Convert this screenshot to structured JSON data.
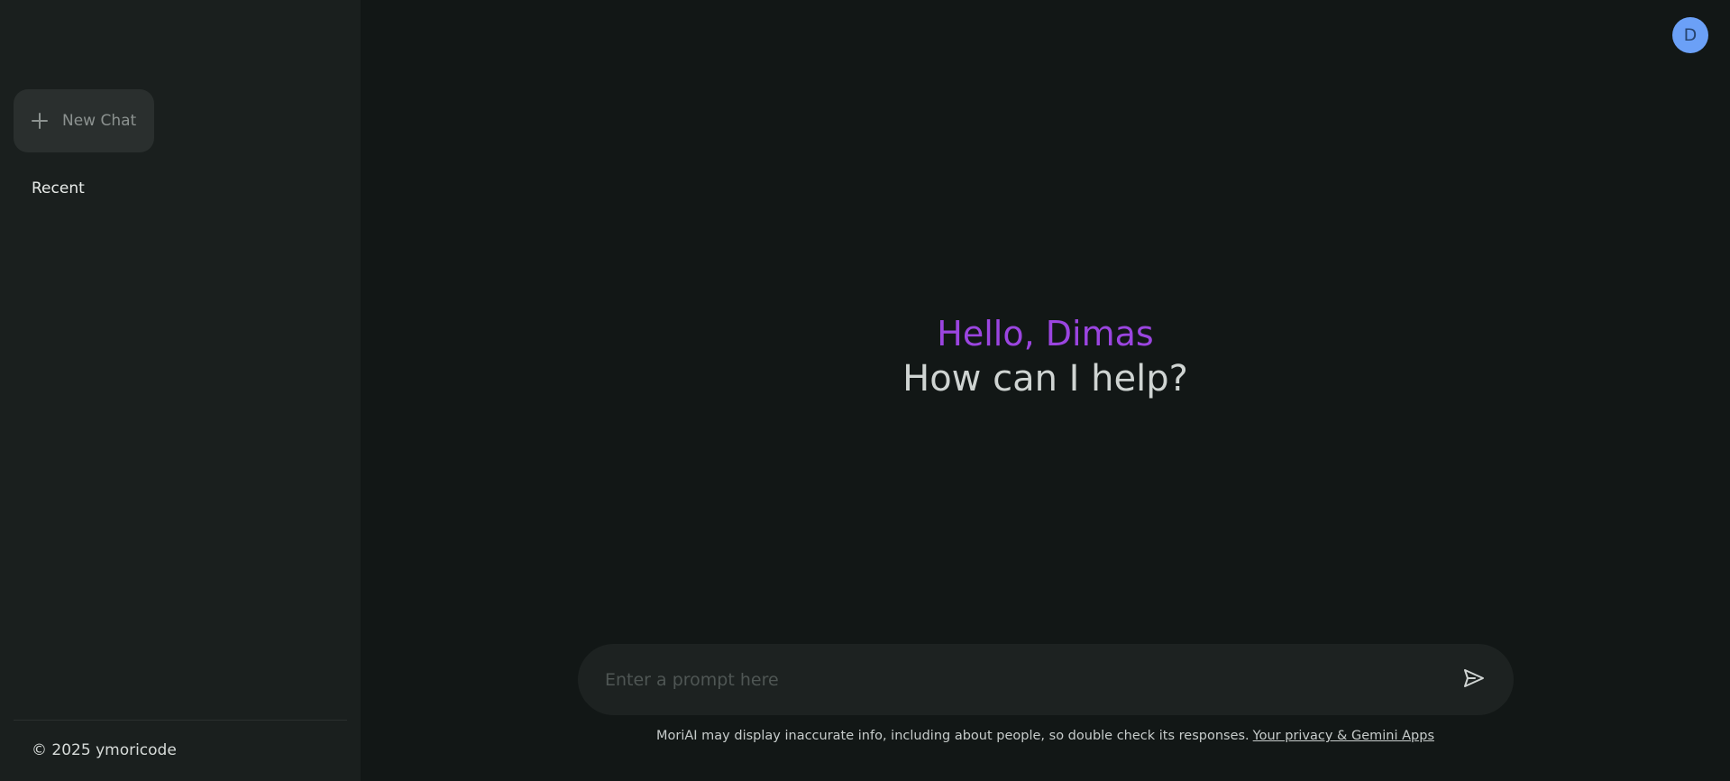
{
  "sidebar": {
    "new_chat_label": "New Chat",
    "recent_label": "Recent",
    "footer": "© 2025 ymoricode"
  },
  "header": {
    "avatar_initial": "D",
    "avatar_color": "#6ba0f7"
  },
  "main": {
    "greeting": "Hello, Dimas",
    "subtitle": "How can I help?",
    "greeting_color": "#9b45e0"
  },
  "prompt": {
    "placeholder": "Enter a prompt here",
    "value": "",
    "send_icon": "send-icon"
  },
  "disclaimer": {
    "text": "MoriAI may display inaccurate info, including about people, so double check its responses.",
    "link_label": "Your privacy & Gemini Apps"
  }
}
